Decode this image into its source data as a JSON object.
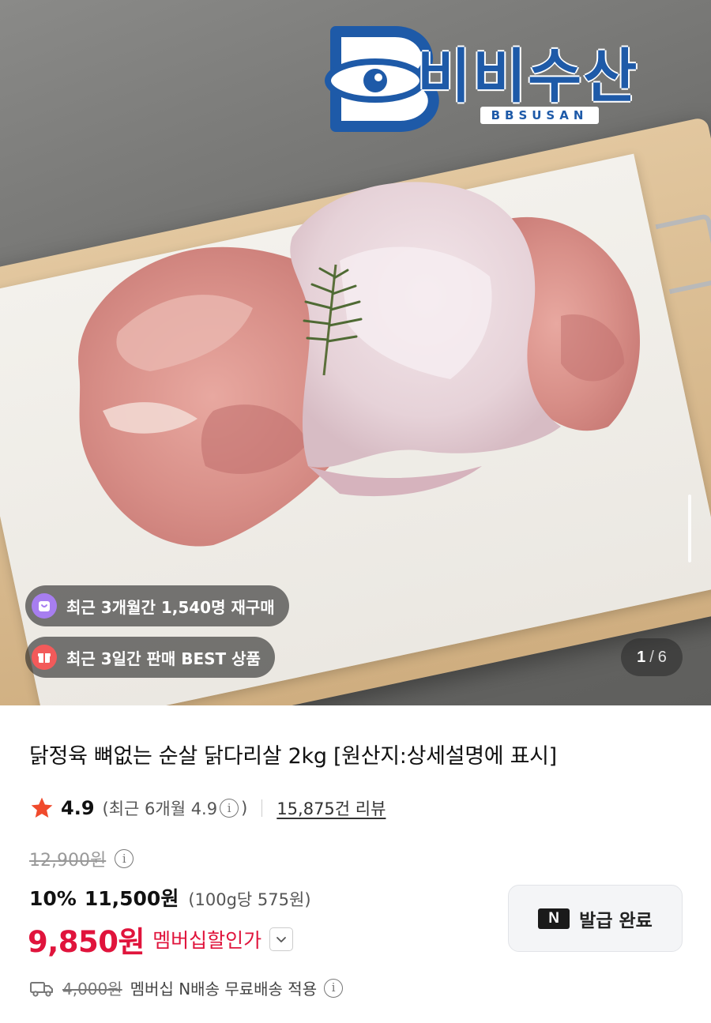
{
  "brand": {
    "name": "비비수산",
    "sub": "BBSUSAN",
    "color": "#1e5aa8"
  },
  "gallery": {
    "badges": [
      {
        "label": "최근 3개월간 1,540명 재구매",
        "icon": "shopping-bag-icon",
        "color": "#a77ef0"
      },
      {
        "label": "최근 3일간 판매 BEST 상품",
        "icon": "gift-box-icon",
        "color": "#f25a5a"
      }
    ],
    "pager": {
      "current": "1",
      "separator": "/",
      "total": "6"
    }
  },
  "product": {
    "title": "닭정육 뼈없는 순살 닭다리살 2kg [원산지:상세설명에 표시]",
    "rating": {
      "score": "4.9",
      "recent_prefix": "(최근 6개월 4.9",
      "recent_suffix": ")",
      "reviews": "15,875건 리뷰"
    },
    "price": {
      "original": "12,900원",
      "discount_rate": "10%",
      "discount_price": "11,500원",
      "unit_price": "(100g당 575원)",
      "member_price": "9,850원",
      "member_label": "멤버십할인가"
    },
    "coupon": {
      "badge": "N",
      "label": "발급 완료"
    },
    "shipping": {
      "original_fee": "4,000원",
      "text": "멤버십 N배송 무료배송 적용"
    }
  },
  "colors": {
    "accent_red": "#e0143c",
    "star": "#f04a2c"
  }
}
